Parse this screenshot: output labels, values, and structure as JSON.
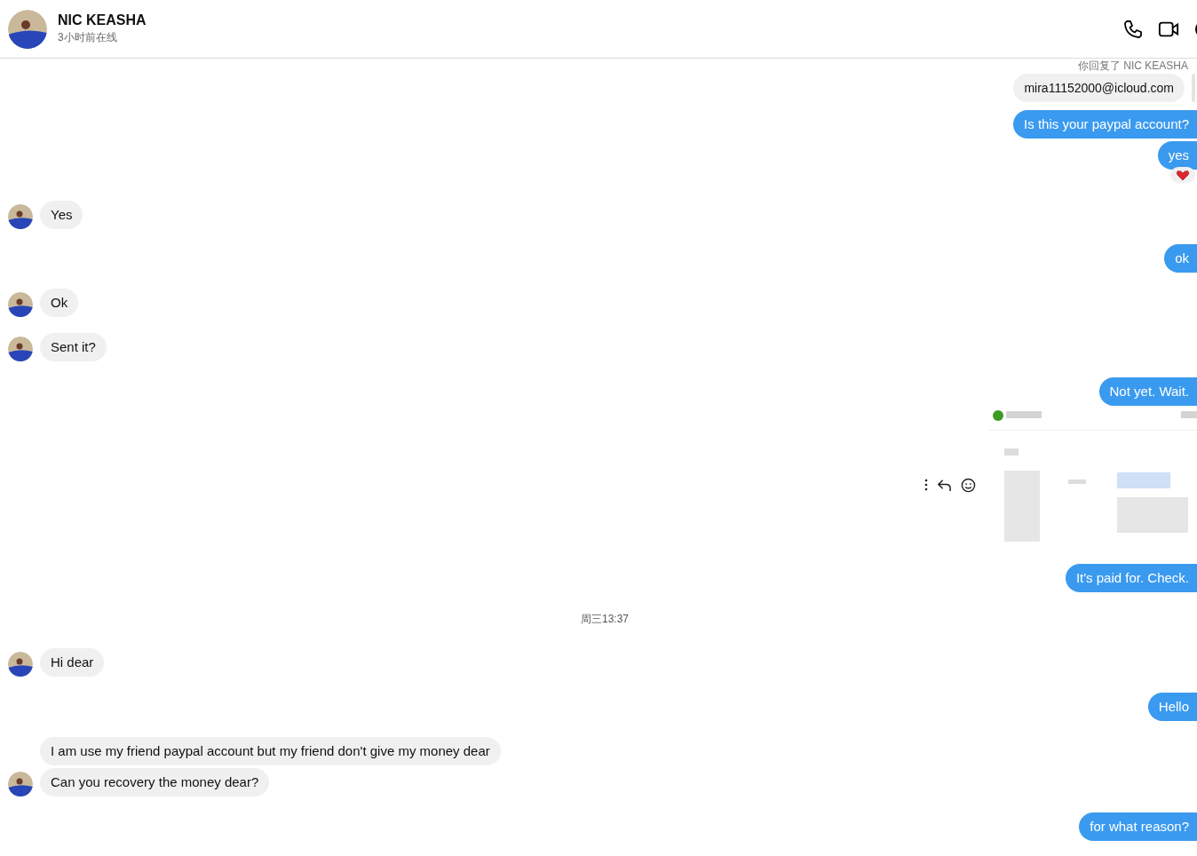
{
  "header": {
    "name": "NIC KEASHA",
    "status": "3小时前在线"
  },
  "messages": [
    {
      "kind": "note",
      "text": "你回复了 NIC KEASHA"
    },
    {
      "kind": "quote",
      "outgoing": true,
      "text": "mira11152000@icloud.com"
    },
    {
      "kind": "text",
      "outgoing": true,
      "text": "Is this your paypal account?"
    },
    {
      "kind": "text",
      "outgoing": true,
      "text": "yes",
      "reacted": true
    },
    {
      "kind": "text",
      "outgoing": false,
      "text": "Yes",
      "avatar": true
    },
    {
      "kind": "text",
      "outgoing": true,
      "text": "ok"
    },
    {
      "kind": "text",
      "outgoing": false,
      "text": "Ok",
      "avatar": true
    },
    {
      "kind": "text",
      "outgoing": false,
      "text": "Sent it?",
      "avatar": true
    },
    {
      "kind": "text",
      "outgoing": true,
      "text": "Not yet. Wait."
    },
    {
      "kind": "picture",
      "outgoing": true
    },
    {
      "kind": "text",
      "outgoing": true,
      "text": "It's paid for. Check."
    },
    {
      "kind": "time",
      "text": "周三13:37"
    },
    {
      "kind": "text",
      "outgoing": false,
      "text": "Hi dear",
      "avatar": true
    },
    {
      "kind": "text",
      "outgoing": true,
      "text": "Hello"
    },
    {
      "kind": "text",
      "outgoing": false,
      "text": "I am use my friend paypal account but my friend don't give my money dear",
      "avatar": false
    },
    {
      "kind": "text",
      "outgoing": false,
      "text": "Can you recovery the money dear?",
      "avatar": true
    },
    {
      "kind": "text",
      "outgoing": true,
      "text": "for what reason?"
    }
  ]
}
